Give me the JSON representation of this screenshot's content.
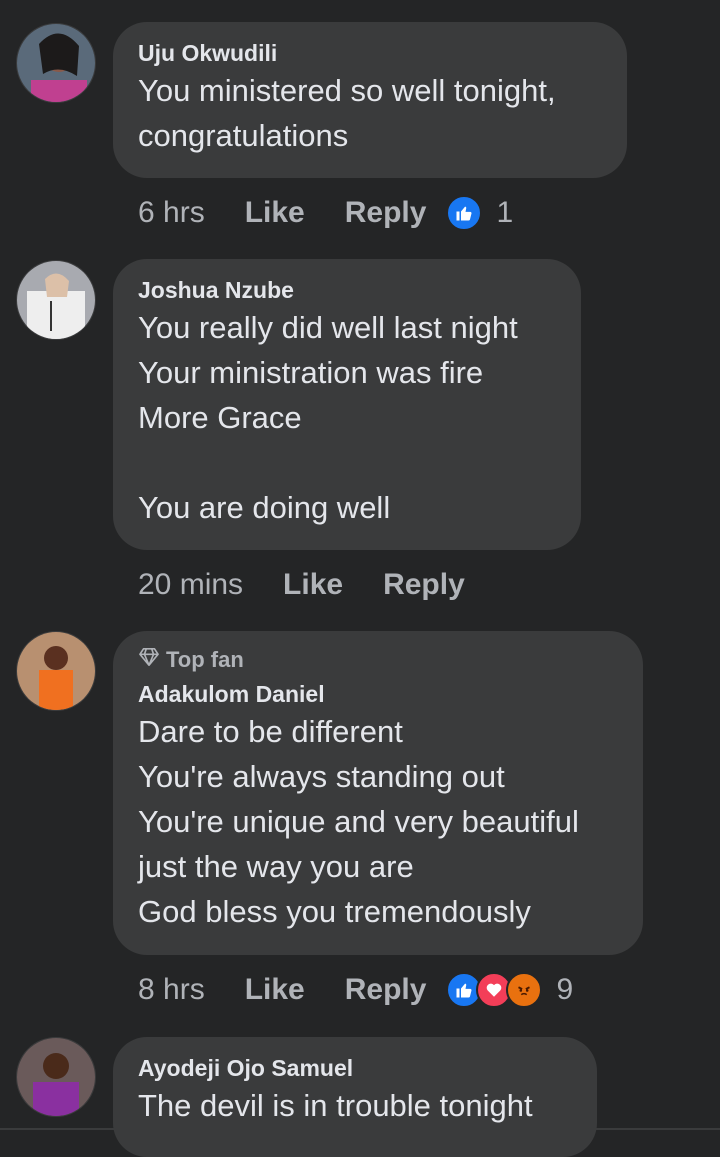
{
  "colors": {
    "background": "#242526",
    "bubble": "#3a3b3c",
    "like_blue": "#1877f2",
    "love_red": "#f33e58",
    "angry_orange": "#e9710f"
  },
  "comments": [
    {
      "author": "Uju Okwudili",
      "top_fan": "",
      "lines": [
        "You ministered so well tonight,",
        "congratulations"
      ],
      "time": "6 hrs",
      "like": "Like",
      "reply": "Reply",
      "reactions": [
        "like-icon"
      ],
      "reaction_count": "1"
    },
    {
      "author": "Joshua Nzube",
      "top_fan": "",
      "lines": [
        "You really did well last night",
        "Your ministration was fire",
        "More Grace",
        "",
        "You are doing well"
      ],
      "time": "20 mins",
      "like": "Like",
      "reply": "Reply",
      "reactions": [],
      "reaction_count": ""
    },
    {
      "author": "Adakulom Daniel",
      "top_fan": "Top fan",
      "lines": [
        "Dare to be different",
        "You're always standing out",
        "You're unique and very beautiful",
        "just the way you are",
        "God bless you tremendously"
      ],
      "time": "8 hrs",
      "like": "Like",
      "reply": "Reply",
      "reactions": [
        "like-icon",
        "love-icon",
        "angry-icon"
      ],
      "reaction_count": "9"
    },
    {
      "author": "Ayodeji Ojo Samuel",
      "top_fan": "",
      "lines": [
        "The devil is in trouble tonight"
      ],
      "time": "",
      "like": "",
      "reply": "",
      "reactions": [],
      "reaction_count": ""
    }
  ]
}
